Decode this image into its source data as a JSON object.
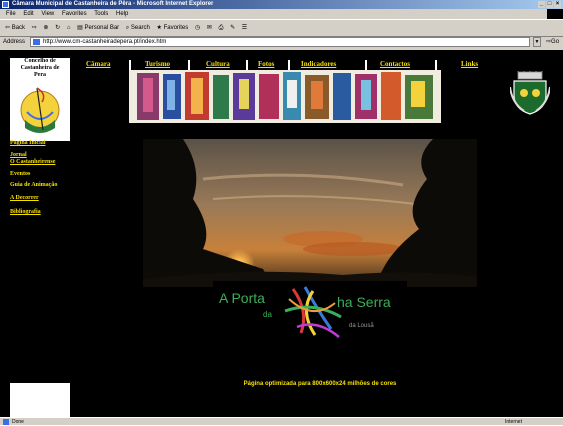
{
  "window": {
    "title": "Câmara Municipal de Castanheira de Pêra - Microsoft Internet Explorer"
  },
  "menu": [
    "File",
    "Edit",
    "View",
    "Favorites",
    "Tools",
    "Help"
  ],
  "toolbar": {
    "back": "Back",
    "personal_bar": "Personal Bar",
    "search": "Search",
    "favorites": "Favorites"
  },
  "address": {
    "label": "Address",
    "url": "http://www.cm-castanheiradepera.pt/index.htm",
    "go": "Go"
  },
  "logo": {
    "text_line1": "Concelho de",
    "text_line2": "Castanheira de",
    "text_line3": "Pera"
  },
  "nav": {
    "items": [
      "Câmara",
      "Turismo",
      "Cultura",
      "Fotos",
      "Indicadores",
      "Contactos",
      "Links"
    ]
  },
  "sidebar": {
    "items": [
      {
        "label": "Página Inicial",
        "underlined": true
      },
      {
        "label": "Jornal",
        "underlined": true
      },
      {
        "label": "O Castanheirense",
        "underlined": true
      },
      {
        "label": "Eventos",
        "underlined": false
      },
      {
        "label": "Guia de Animação",
        "underlined": false
      },
      {
        "label": "A Decorrer",
        "underlined": true
      },
      {
        "label": "Bibliografia",
        "underlined": true
      }
    ]
  },
  "aporta": {
    "line1_a": "A Porta",
    "line1_b": "ha Serra",
    "line2": "da",
    "line3": "da Lousã"
  },
  "footer": {
    "optimized": "Página optimizada para 800x600x24 milhões de cores"
  },
  "status": {
    "left": "Done",
    "right": "Internet"
  },
  "colors": {
    "link_yellow": "#f6e000",
    "content_bg": "#000000",
    "chrome": "#d4d0c8",
    "title_blue": "#0a246a"
  }
}
